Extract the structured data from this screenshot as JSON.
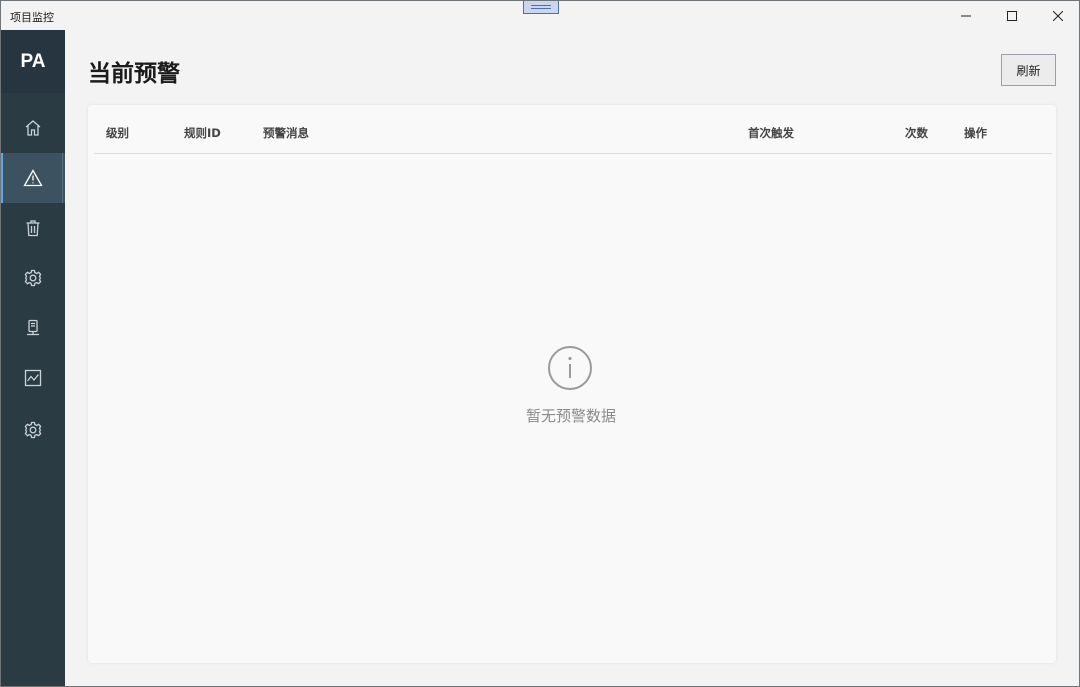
{
  "window": {
    "title": "项目监控"
  },
  "sidebar": {
    "brand": "PA",
    "items": [
      {
        "icon": "home-icon"
      },
      {
        "icon": "warning-icon",
        "active": true
      },
      {
        "icon": "trash-icon"
      },
      {
        "icon": "gear-icon"
      },
      {
        "icon": "server-icon"
      },
      {
        "icon": "chart-icon"
      },
      {
        "icon": "gear-icon"
      }
    ]
  },
  "header": {
    "title": "当前预警",
    "refresh_label": "刷新"
  },
  "table": {
    "columns": [
      "级别",
      "规则ID",
      "预警消息",
      "首次触发",
      "次数",
      "操作"
    ],
    "rows": []
  },
  "empty_state": {
    "icon": "info-icon",
    "text": "暂无预警数据"
  },
  "colors": {
    "sidebar": "#2b3b44",
    "active_accent": "#5fa8e0"
  }
}
